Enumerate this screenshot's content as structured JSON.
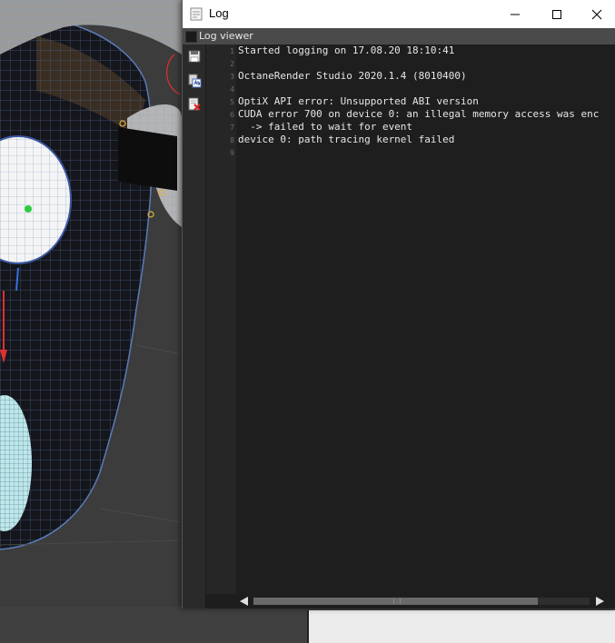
{
  "window": {
    "title": "Log",
    "icons": {
      "app": "app-icon",
      "minimize": "minimize-icon",
      "maximize": "maximize-icon",
      "close": "close-icon"
    }
  },
  "panel": {
    "title": "Log viewer",
    "icon": "panel-icon"
  },
  "toolbar": {
    "items": [
      {
        "icon": "save-icon"
      },
      {
        "icon": "copy-text-icon"
      },
      {
        "icon": "clear-log-icon"
      }
    ]
  },
  "log": {
    "line_numbers": [
      "1",
      "2",
      "3",
      "4",
      "5",
      "6",
      "7",
      "8",
      "9"
    ],
    "lines": [
      "Started logging on 17.08.20 18:10:41",
      "",
      "OctaneRender Studio 2020.1.4 (8010400)",
      "",
      "OptiX API error: Unsupported ABI version",
      "CUDA error 700 on device 0: an illegal memory access was enc",
      "  -> failed to wait for event",
      "device 0: path tracing kernel failed",
      ""
    ]
  },
  "scrollbar": {
    "position": 0.85
  },
  "colors": {
    "log_background": "#1e1e1e",
    "log_text": "#e6e6e6",
    "title_bar": "#ffffff",
    "panel_header": "#4a4a4a",
    "viewport_background": "#3a3a3a",
    "wireframe": "#6e8ec4"
  }
}
